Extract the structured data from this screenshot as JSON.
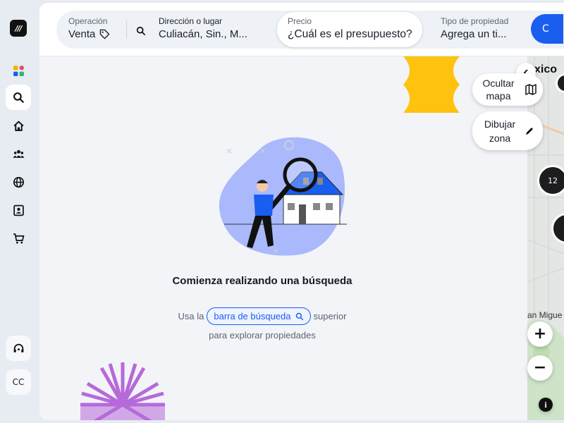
{
  "brand": {
    "logo_text": "///"
  },
  "sidebar": {
    "items": [
      {
        "name": "apps-icon"
      },
      {
        "name": "search-icon",
        "active": true
      },
      {
        "name": "home-icon"
      },
      {
        "name": "people-icon"
      },
      {
        "name": "globe-icon"
      },
      {
        "name": "contact-card-icon"
      },
      {
        "name": "cart-icon"
      }
    ],
    "support_icon": "headset-icon",
    "user_initials": "CC"
  },
  "search": {
    "operation": {
      "label": "Operación",
      "value": "Venta"
    },
    "address": {
      "label": "Dirección o lugar",
      "value": "Culiacán, Sin., M..."
    },
    "price": {
      "label": "Precio",
      "value": "¿Cuál es el presupuesto?"
    },
    "property_type": {
      "label": "Tipo de propiedad",
      "value": "Agrega un ti..."
    },
    "submit_label": "C"
  },
  "map": {
    "hide_map_label": "Ocultar mapa",
    "draw_zone_label": "Dibujar zona",
    "cluster_count": "12",
    "label_top": "xico",
    "label_neighborhood": "an Migue",
    "zoom_in": "+",
    "zoom_out": "−",
    "info": "i"
  },
  "empty_state": {
    "title": "Comienza realizando una búsqueda",
    "line1_prefix": "Usa la",
    "chip_label": "barra de búsqueda",
    "line1_suffix": "superior",
    "line2": "para explorar propiedades"
  },
  "colors": {
    "accent": "#1a5ef0",
    "yellow": "#ffc20e",
    "purple": "#b66ad9",
    "illustration_blob": "#a9b9fb"
  }
}
